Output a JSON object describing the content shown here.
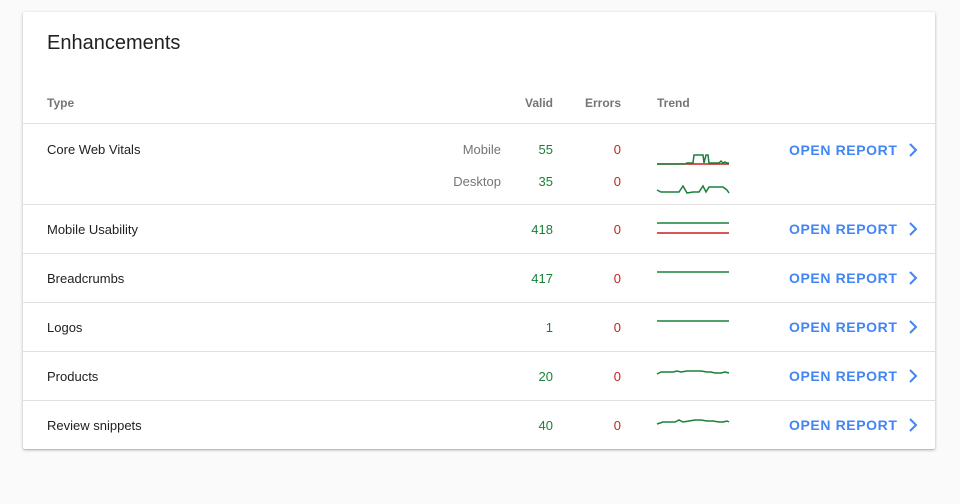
{
  "card": {
    "title": "Enhancements",
    "columns": {
      "type": "Type",
      "valid": "Valid",
      "errors": "Errors",
      "trend": "Trend"
    },
    "link_label": "OPEN REPORT",
    "colors": {
      "valid": "#188038",
      "error": "#c5221f",
      "link": "#4285f4"
    },
    "rows": [
      {
        "type": "Core Web Vitals",
        "sub": [
          {
            "device": "Mobile",
            "valid": "55",
            "errors": "0"
          },
          {
            "device": "Desktop",
            "valid": "35",
            "errors": "0"
          }
        ]
      },
      {
        "type": "Mobile Usability",
        "valid": "418",
        "errors": "0"
      },
      {
        "type": "Breadcrumbs",
        "valid": "417",
        "errors": "0"
      },
      {
        "type": "Logos",
        "valid": "1",
        "errors": "0"
      },
      {
        "type": "Products",
        "valid": "20",
        "errors": "0"
      },
      {
        "type": "Review snippets",
        "valid": "40",
        "errors": "0"
      }
    ]
  }
}
